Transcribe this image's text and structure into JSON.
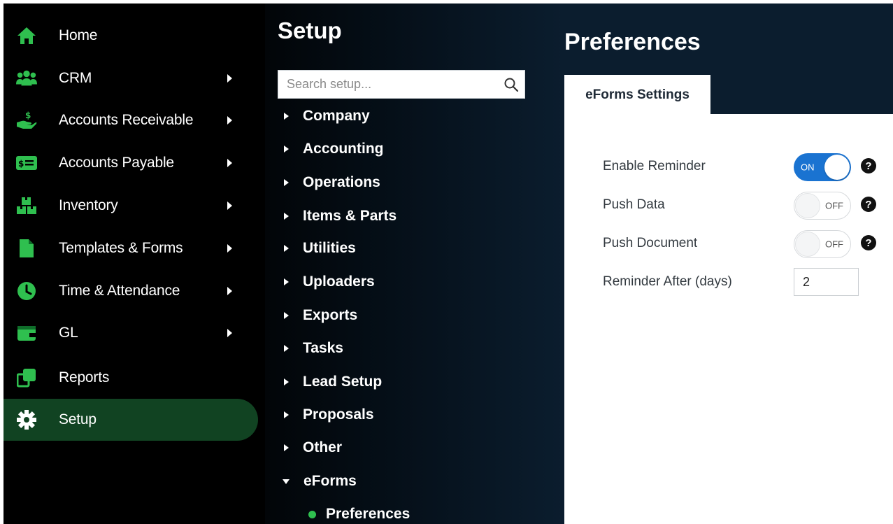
{
  "colors": {
    "accent_green": "#2fbf4f",
    "active_nav_bg": "#114322",
    "toggle_on": "#1a73d1",
    "header_bg": "#0b1d2e"
  },
  "sidebar": {
    "items": [
      {
        "label": "Home",
        "icon": "home-icon",
        "has_submenu": false,
        "active": false
      },
      {
        "label": "CRM",
        "icon": "users-icon",
        "has_submenu": true,
        "active": false
      },
      {
        "label": "Accounts Receivable",
        "icon": "hand-dollar-icon",
        "has_submenu": true,
        "active": false
      },
      {
        "label": "Accounts Payable",
        "icon": "money-bill-icon",
        "has_submenu": true,
        "active": false
      },
      {
        "label": "Inventory",
        "icon": "boxes-icon",
        "has_submenu": true,
        "active": false
      },
      {
        "label": "Templates & Forms",
        "icon": "file-icon",
        "has_submenu": true,
        "active": false
      },
      {
        "label": "Time & Attendance",
        "icon": "clock-icon",
        "has_submenu": true,
        "active": false
      },
      {
        "label": "GL",
        "icon": "wallet-icon",
        "has_submenu": true,
        "active": false
      },
      {
        "label": "Reports",
        "icon": "copy-icon",
        "has_submenu": false,
        "active": false
      },
      {
        "label": "Setup",
        "icon": "gear-icon",
        "has_submenu": false,
        "active": true
      }
    ]
  },
  "setup": {
    "title": "Setup",
    "search_placeholder": "Search setup...",
    "tree": [
      {
        "label": "Company",
        "expanded": false
      },
      {
        "label": "Accounting",
        "expanded": false
      },
      {
        "label": "Operations",
        "expanded": false
      },
      {
        "label": "Items & Parts",
        "expanded": false
      },
      {
        "label": "Utilities",
        "expanded": false
      },
      {
        "label": "Uploaders",
        "expanded": false
      },
      {
        "label": "Exports",
        "expanded": false
      },
      {
        "label": "Tasks",
        "expanded": false
      },
      {
        "label": "Lead Setup",
        "expanded": false
      },
      {
        "label": "Proposals",
        "expanded": false
      },
      {
        "label": "Other",
        "expanded": false
      },
      {
        "label": "eForms",
        "expanded": true
      }
    ],
    "sub_items": [
      {
        "label": "Preferences",
        "selected": true
      }
    ]
  },
  "preferences": {
    "title": "Preferences",
    "tab_label": "eForms Settings",
    "settings": {
      "enable_reminder": {
        "label": "Enable Reminder",
        "state": "ON",
        "enabled": true
      },
      "push_data": {
        "label": "Push Data",
        "state": "OFF",
        "enabled": false
      },
      "push_document": {
        "label": "Push Document",
        "state": "OFF",
        "enabled": false
      },
      "reminder_after": {
        "label": "Reminder After (days)",
        "value": "2"
      }
    },
    "help_glyph": "?"
  }
}
